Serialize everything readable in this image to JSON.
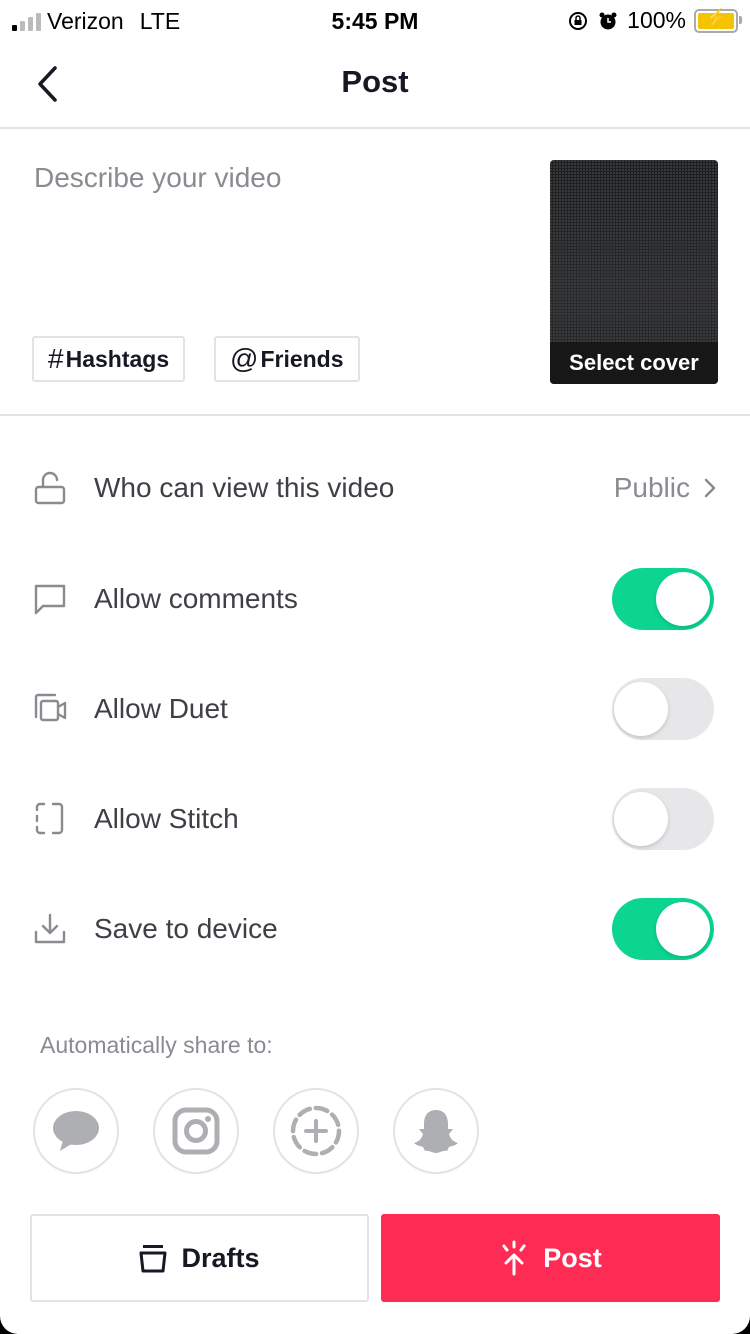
{
  "status_bar": {
    "carrier": "Verizon",
    "network": "LTE",
    "time": "5:45 PM",
    "battery": "100%",
    "signal_bars_active": 1,
    "signal_bars_total": 4
  },
  "header": {
    "title": "Post",
    "back_icon": "chevron-left-icon"
  },
  "compose": {
    "description_placeholder": "Describe your video",
    "chips": [
      {
        "symbol": "#",
        "label": "Hashtags"
      },
      {
        "symbol": "@",
        "label": "Friends"
      }
    ],
    "cover_label": "Select cover"
  },
  "settings": [
    {
      "icon": "lock-open-icon",
      "label": "Who can view this video",
      "value": "Public",
      "type": "link"
    },
    {
      "icon": "comment-icon",
      "label": "Allow comments",
      "type": "toggle",
      "on": true
    },
    {
      "icon": "duet-icon",
      "label": "Allow Duet",
      "type": "toggle",
      "on": false
    },
    {
      "icon": "stitch-icon",
      "label": "Allow Stitch",
      "type": "toggle",
      "on": false
    },
    {
      "icon": "download-icon",
      "label": "Save to device",
      "type": "toggle",
      "on": true
    }
  ],
  "share": {
    "label": "Automatically share to:",
    "targets": [
      "messages-icon",
      "instagram-icon",
      "story-add-icon",
      "snapchat-icon"
    ]
  },
  "actions": {
    "drafts_label": "Drafts",
    "post_label": "Post"
  },
  "colors": {
    "accent": "#fe2c55",
    "toggle_on": "#0bd58f",
    "toggle_off": "#e7e7e9"
  }
}
